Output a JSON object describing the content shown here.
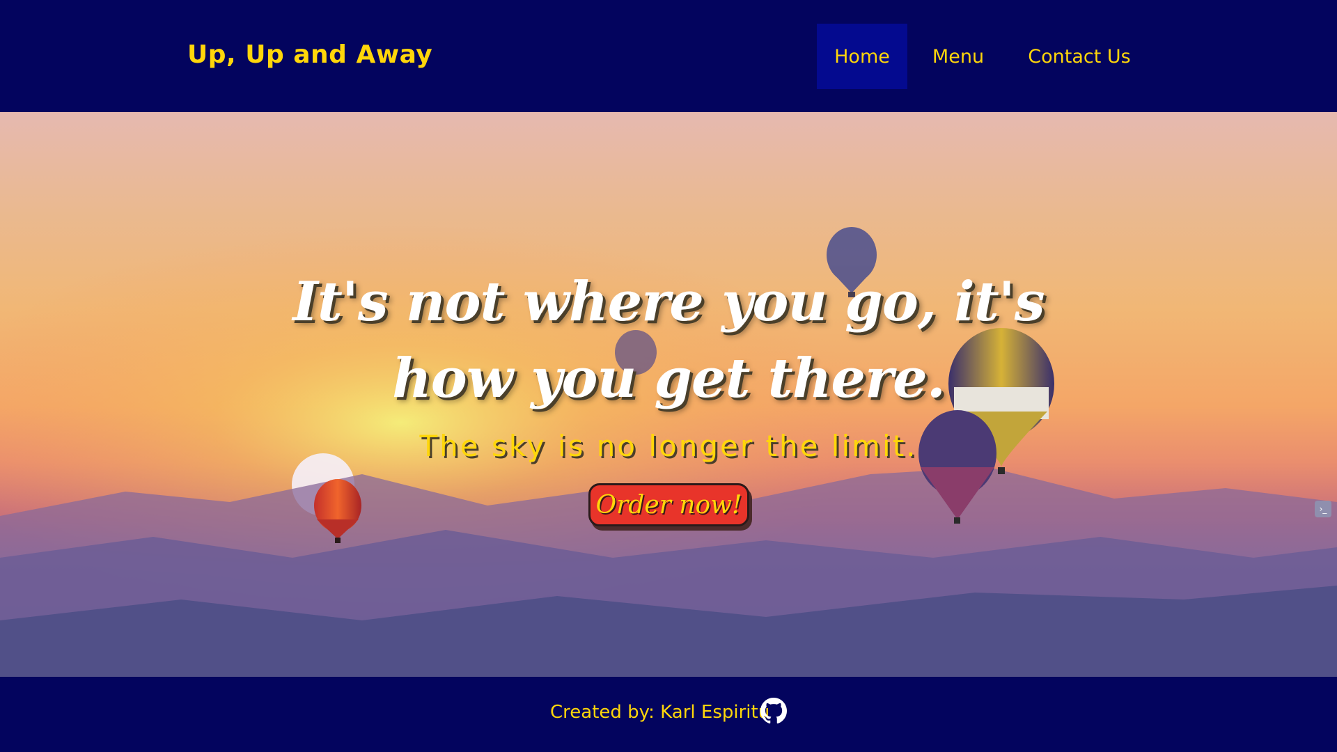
{
  "header": {
    "brand": "Up, Up and Away",
    "nav": [
      {
        "label": "Home",
        "active": true
      },
      {
        "label": "Menu",
        "active": false
      },
      {
        "label": "Contact Us",
        "active": false
      }
    ]
  },
  "hero": {
    "headline": "It's not where you go, it's how you get there.",
    "subline": "The sky is no longer the limit.",
    "cta_label": "Order now!"
  },
  "footer": {
    "credit": "Created by: Karl Espiritu",
    "icon": "github-icon"
  },
  "colors": {
    "navy": "#03045e",
    "accent_yellow": "#ffd60a",
    "active_nav": "#040a8f",
    "cta_red": "#e8342a"
  }
}
